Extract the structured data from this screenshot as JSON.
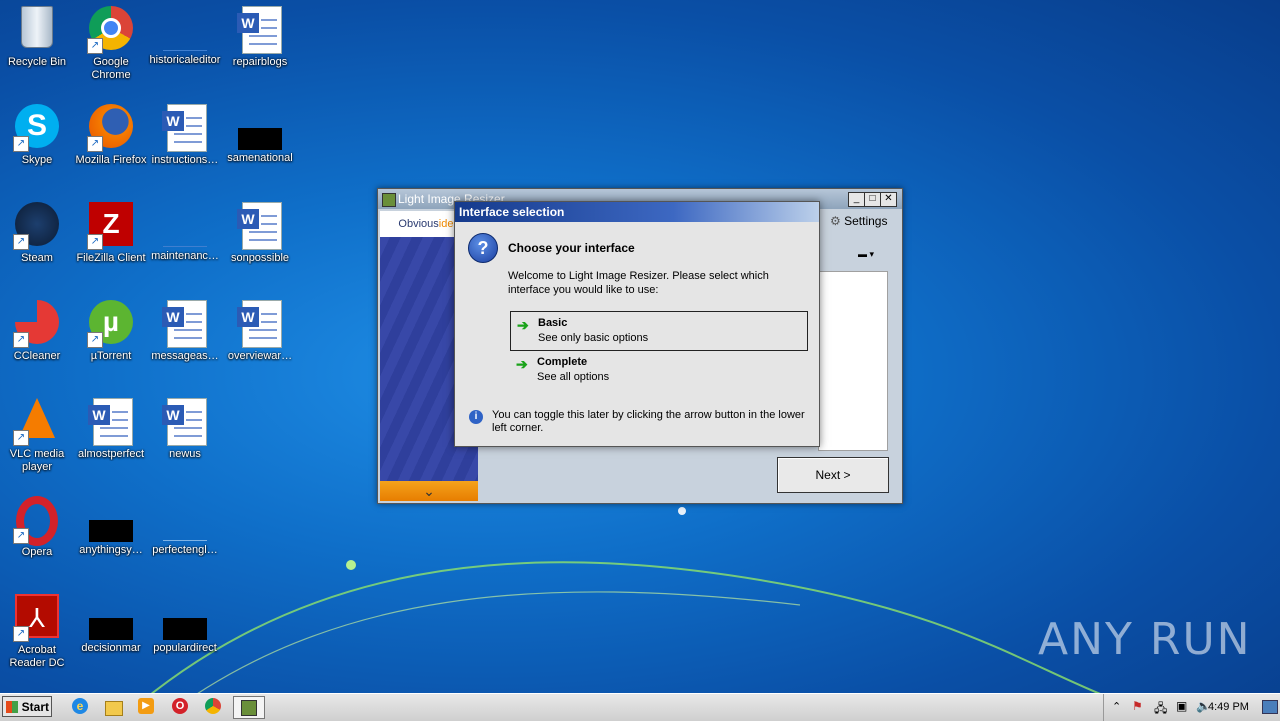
{
  "desktop": {
    "icons": [
      {
        "label": "Recycle Bin"
      },
      {
        "label": "Google Chrome"
      },
      {
        "label": "historicaleditor"
      },
      {
        "label": "repairblogs"
      },
      {
        "label": "Skype"
      },
      {
        "label": "Mozilla Firefox"
      },
      {
        "label": "instructions…"
      },
      {
        "label": "samenational"
      },
      {
        "label": "Steam"
      },
      {
        "label": "FileZilla Client"
      },
      {
        "label": "maintenanc…"
      },
      {
        "label": "sonpossible"
      },
      {
        "label": "CCleaner"
      },
      {
        "label": "µTorrent"
      },
      {
        "label": "messageas…"
      },
      {
        "label": "overviewar…"
      },
      {
        "label": "VLC media player"
      },
      {
        "label": "almostperfect"
      },
      {
        "label": "newus"
      },
      {
        "label": "Opera"
      },
      {
        "label": "anythingsy…"
      },
      {
        "label": "perfectengl…"
      },
      {
        "label": "Acrobat Reader DC"
      },
      {
        "label": "decisionmar"
      },
      {
        "label": "populardirect"
      }
    ]
  },
  "main_window": {
    "title": "Light Image Resizer",
    "logo_a": "Obvious",
    "logo_b": "idea",
    "settings_label": "Settings",
    "next_label": "Next >"
  },
  "dialog": {
    "title": "Interface selection",
    "heading": "Choose your interface",
    "intro": "Welcome to Light Image Resizer. Please select which interface you would like to use:",
    "options": [
      {
        "title": "Basic",
        "subtitle": "See only basic options"
      },
      {
        "title": "Complete",
        "subtitle": "See all options"
      }
    ],
    "note": "You can toggle this later by clicking the arrow button in the lower left corner."
  },
  "taskbar": {
    "start_label": "Start",
    "clock": "4:49 PM"
  },
  "watermark": "ANY RUN"
}
